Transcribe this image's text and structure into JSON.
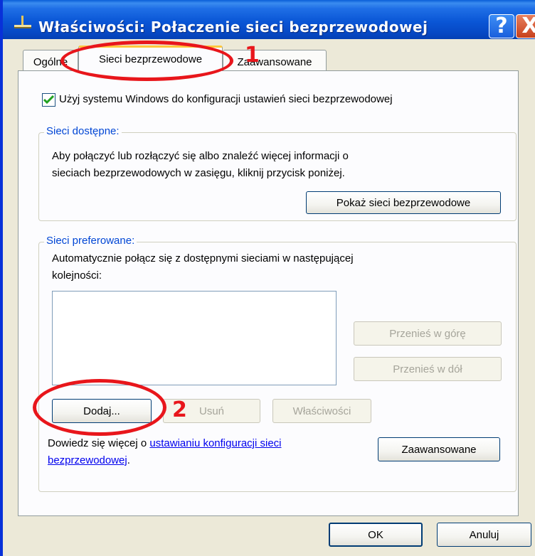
{
  "window": {
    "title": "Właściwości: Połaczenie sieci bezprzewodowej",
    "help_button": "?",
    "close_button": "X"
  },
  "tabs": [
    {
      "label": "Ogólne"
    },
    {
      "label": "Sieci bezprzewodowe"
    },
    {
      "label": "Zaawansowane"
    }
  ],
  "settings": {
    "use_windows_checkbox": {
      "checked": true,
      "label": "Użyj systemu Windows do konfiguracji ustawień sieci bezprzewodowej"
    }
  },
  "available_networks": {
    "title": "Sieci dostępne:",
    "description_line1": "Aby połączyć lub rozłączyć się albo znaleźć więcej informacji o",
    "description_line2": "sieciach bezprzewodowych w zasięgu, kliknij przycisk poniżej.",
    "show_button": "Pokaż sieci bezprzewodowe"
  },
  "preferred_networks": {
    "title": "Sieci preferowane:",
    "description_line1": "Automatycznie połącz się z dostępnymi sieciami w następującej",
    "description_line2": "kolejności:",
    "networks": [],
    "move_up_button": "Przenieś w górę",
    "move_down_button": "Przenieś w dół",
    "add_button": "Dodaj...",
    "remove_button": "Usuń",
    "properties_button": "Właściwości"
  },
  "learn_more": {
    "prefix": "Dowiedz się więcej o",
    "link_line1": "ustawianiu konfiguracji sieci",
    "link_line2": "bezprzewodowej",
    "suffix": "."
  },
  "advanced_button": "Zaawansowane",
  "footer": {
    "ok_button": "OK",
    "cancel_button": "Anuluj"
  },
  "annotations": [
    {
      "number": "1"
    },
    {
      "number": "2"
    }
  ],
  "colors": {
    "titlebar": "#0a56d6",
    "group_title": "#0046d5",
    "annotation": "#e8161b",
    "active_tab_highlight": "#ffc83c"
  }
}
